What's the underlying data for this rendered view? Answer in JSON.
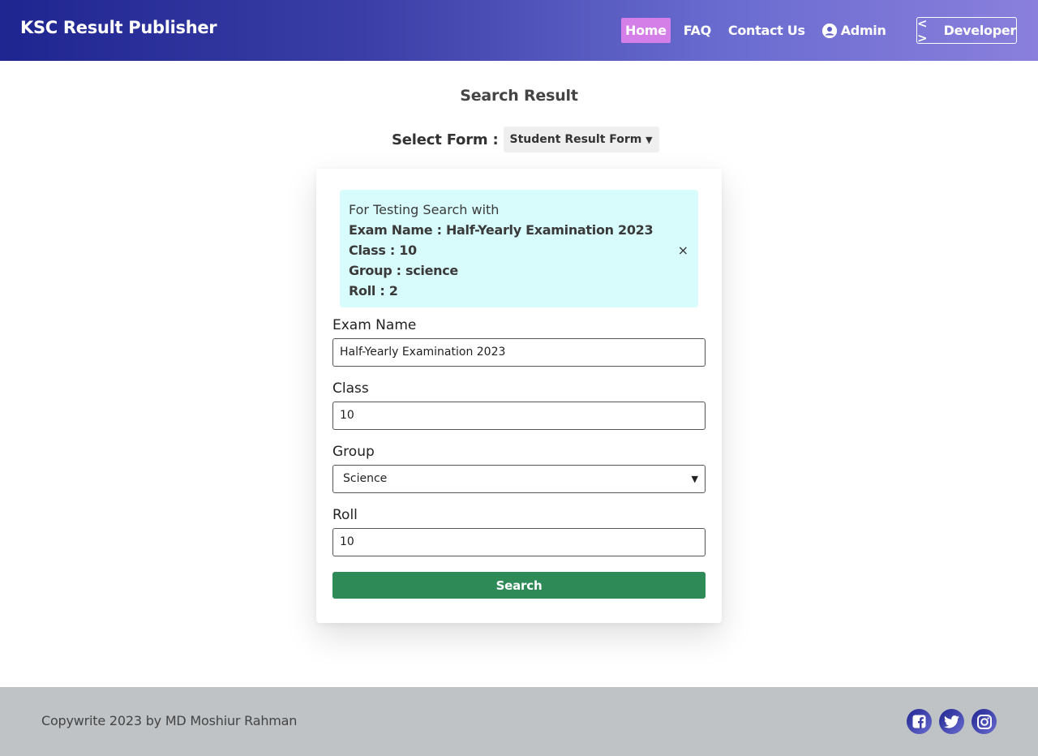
{
  "header": {
    "brand": "KSC Result Publisher",
    "nav": [
      {
        "label": "Home",
        "active": true
      },
      {
        "label": "FAQ",
        "active": false
      },
      {
        "label": "Contact Us",
        "active": false
      },
      {
        "label": "Admin",
        "icon": "user-circle-icon",
        "active": false
      }
    ],
    "developer_label": "Developer",
    "developer_icon": "code-brackets-icon"
  },
  "main": {
    "title": "Search Result",
    "form_select": {
      "label": "Select Form :",
      "value": "Student Result Form"
    },
    "alert": {
      "intro": "For Testing Search with",
      "lines": [
        "Exam Name : Half-Yearly Examination 2023",
        "Class : 10",
        "Group : science",
        "Roll : 2"
      ],
      "close_glyph": "×"
    },
    "fields": {
      "exam_name": {
        "label": "Exam Name",
        "value": "Half-Yearly Examination 2023"
      },
      "class": {
        "label": "Class",
        "value": "10"
      },
      "group": {
        "label": "Group",
        "value": "Science"
      },
      "roll": {
        "label": "Roll",
        "value": "10"
      }
    },
    "search_label": "Search"
  },
  "footer": {
    "copyright": "Copywrite 2023 by MD Moshiur Rahman",
    "socials": [
      "facebook-icon",
      "twitter-icon",
      "instagram-icon"
    ]
  },
  "colors": {
    "nav_gradient_start": "#1f2590",
    "nav_gradient_end": "#8a7fdc",
    "active_nav": "#d47ee8",
    "alert_bg": "#d8fcfc",
    "search_button": "#2e8b57",
    "footer_bg": "#bfc3c6"
  }
}
